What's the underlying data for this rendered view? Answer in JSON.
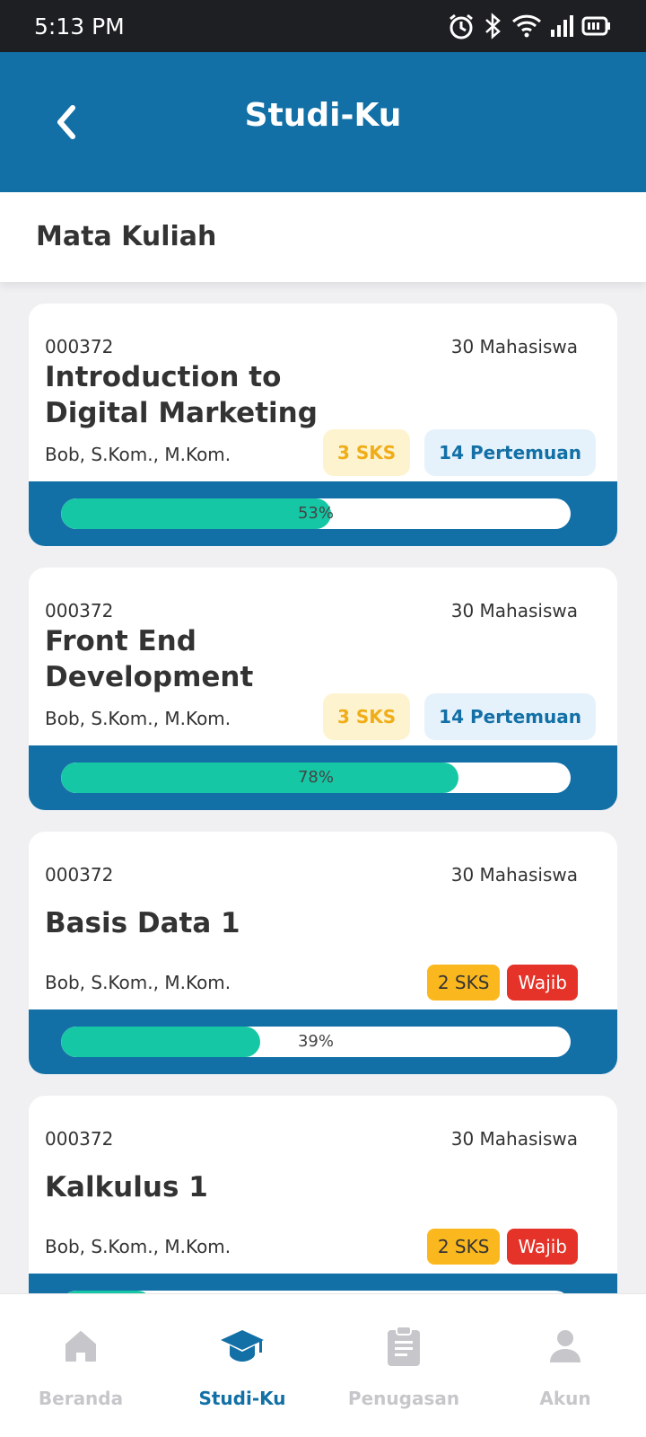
{
  "status_bar": {
    "time": "5:13 PM"
  },
  "app_bar": {
    "title": "Studi-Ku"
  },
  "section": {
    "title": "Mata Kuliah"
  },
  "courses": [
    {
      "code": "000372",
      "students": "30 Mahasiswa",
      "title": "Introduction to Digital Marketing",
      "lecturer": "Bob, S.Kom., M.Kom.",
      "sks": "3 SKS",
      "extra": "14 Pertemuan",
      "progress": 53,
      "progress_label": "53%"
    },
    {
      "code": "000372",
      "students": "30 Mahasiswa",
      "title": "Front End Development",
      "lecturer": "Bob, S.Kom., M.Kom.",
      "sks": "3 SKS",
      "extra": "14 Pertemuan",
      "progress": 78,
      "progress_label": "78%"
    },
    {
      "code": "000372",
      "students": "30 Mahasiswa",
      "title": "Basis Data 1",
      "lecturer": "Bob, S.Kom., M.Kom.",
      "sks": "2 SKS",
      "extra": "Wajib",
      "progress": 39,
      "progress_label": "39%"
    },
    {
      "code": "000372",
      "students": "30 Mahasiswa",
      "title": "Kalkulus 1",
      "lecturer": "Bob, S.Kom., M.Kom.",
      "sks": "2 SKS",
      "extra": "Wajib",
      "progress": 18,
      "progress_label": ""
    }
  ],
  "bottom_nav": [
    {
      "label": "Beranda",
      "icon": "home-icon",
      "active": false
    },
    {
      "label": "Studi-Ku",
      "icon": "graduation-cap-icon",
      "active": true
    },
    {
      "label": "Penugasan",
      "icon": "clipboard-icon",
      "active": false
    },
    {
      "label": "Akun",
      "icon": "user-icon",
      "active": false
    }
  ],
  "colors": {
    "primary": "#1270a6",
    "progress": "#15c7a5",
    "sks_light": "#fdf3cf",
    "sks_solid": "#fbb81e",
    "wajib": "#e53329"
  }
}
